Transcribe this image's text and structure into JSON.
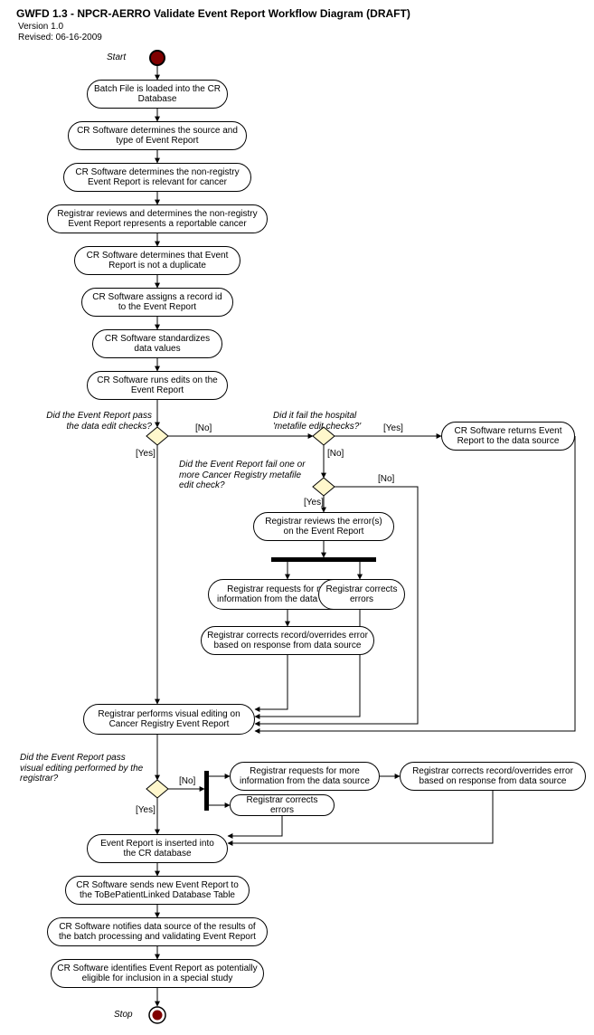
{
  "chart_data": {
    "type": "activity-diagram",
    "title": "GWFD 1.3 - NPCR-AERRO Validate Event Report Workflow Diagram (DRAFT)",
    "version": "Version 1.0",
    "revised": "Revised: 06-16-2009",
    "start_label": "Start",
    "stop_label": "Stop",
    "nodes": {
      "n1": "Batch File is loaded into the CR Database",
      "n2": "CR Software determines the source and type of Event Report",
      "n3": "CR Software determines the non-registry Event Report is relevant for cancer",
      "n4": "Registrar reviews and determines the non-registry Event Report represents a reportable cancer",
      "n5": "CR Software determines that Event Report is not a duplicate",
      "n6": "CR Software assigns a record id to the Event Report",
      "n7": "CR Software standardizes data values",
      "n8": "CR Software runs edits on the Event Report",
      "n9": "CR Software returns Event Report to the data source",
      "n10": "Registrar reviews the error(s) on the Event Report",
      "n11": "Registrar requests for more information from the data source",
      "n12": "Registrar corrects errors",
      "n13": "Registrar corrects record/overrides error based on response from data source",
      "n14": "Registrar performs visual editing on Cancer Registry Event Report",
      "n15": "Registrar requests for more information from the data source",
      "n16": "Registrar corrects errors",
      "n17": "Registrar corrects record/overrides error based on response from data source",
      "n18": "Event Report is inserted into the CR database",
      "n19": "CR Software sends new Event Report to the ToBePatientLinked Database Table",
      "n20": "CR Software notifies data source of the results of the batch processing and validating Event Report",
      "n21": "CR Software identifies Event Report as potentially eligible for inclusion in a special study"
    },
    "decisions": {
      "q1": "Did the Event Report pass the data edit checks?",
      "q2": "Did it fail the hospital 'metafile edit checks?'",
      "q3": "Did the Event Report fail one or more Cancer Registry metafile edit check?",
      "q4": "Did the Event Report pass visual editing performed by the registrar?"
    },
    "edge_labels": {
      "yes": "[Yes]",
      "no": "[No]"
    }
  }
}
